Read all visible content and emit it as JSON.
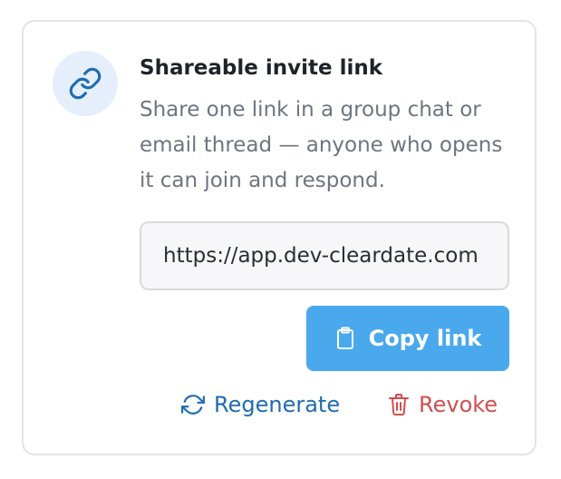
{
  "invite": {
    "title": "Shareable invite link",
    "description": "Share one link in a group chat or email thread — anyone who opens it can join and respond.",
    "link_value": "https://app.dev-cleardate.com",
    "copy_label": "Copy link",
    "regenerate_label": "Regenerate",
    "revoke_label": "Revoke"
  },
  "icons": {
    "badge": "link-icon",
    "copy": "clipboard-icon",
    "regenerate": "refresh-icon",
    "revoke": "trash-icon"
  },
  "colors": {
    "accent": "#4aa8ed",
    "link_blue": "#1f6cb3",
    "danger": "#cf4f4f",
    "badge_bg": "#e4effb"
  }
}
